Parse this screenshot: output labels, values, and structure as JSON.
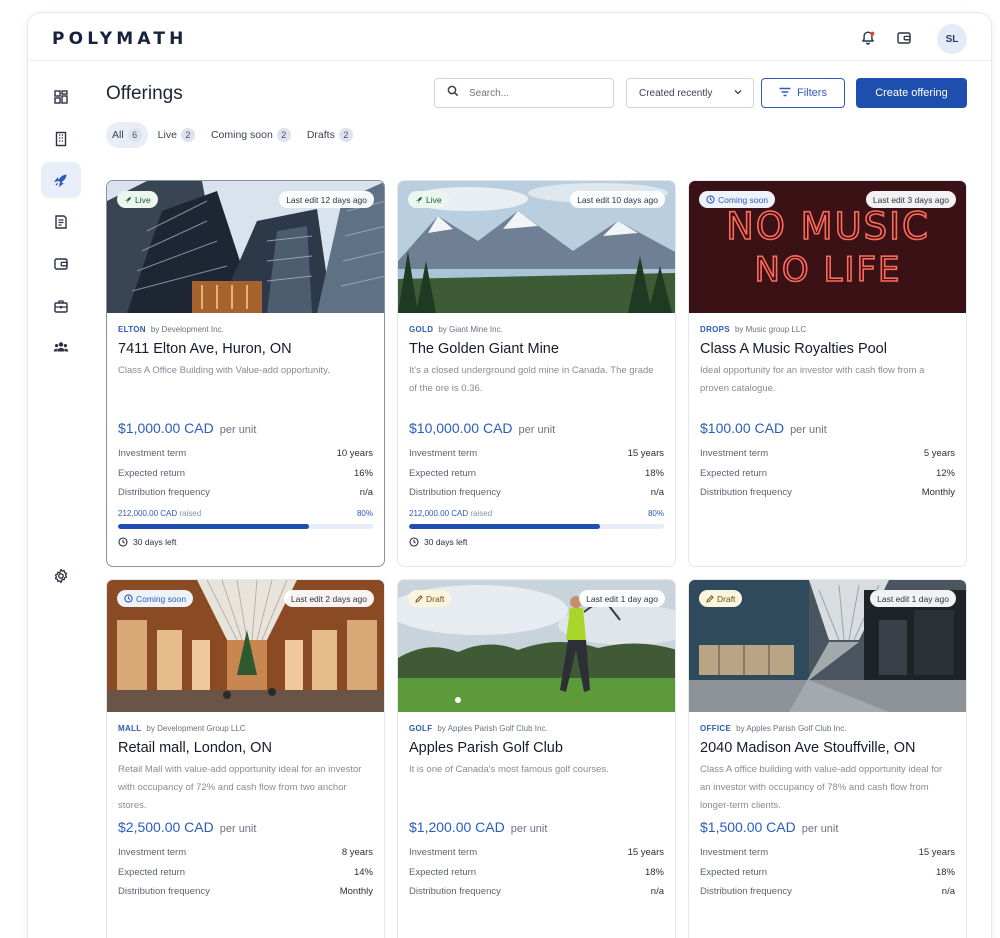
{
  "app": {
    "logo": "POLYMATH",
    "user_initials": "SL"
  },
  "page": {
    "title": "Offerings"
  },
  "toolbar": {
    "search_placeholder": "Search...",
    "sort_label": "Created recently",
    "filters_label": "Filters",
    "create_label": "Create offering"
  },
  "tabs": [
    {
      "label": "All",
      "count": "6"
    },
    {
      "label": "Live",
      "count": "2"
    },
    {
      "label": "Coming soon",
      "count": "2"
    },
    {
      "label": "Drafts",
      "count": "2"
    }
  ],
  "sidebar_icons": [
    "dashboard-icon",
    "building-icon",
    "rocket-icon",
    "document-icon",
    "wallet-icon",
    "briefcase-icon",
    "users-icon",
    "settings-icon"
  ],
  "labels": {
    "per_unit": "per unit",
    "raised": "raised"
  },
  "cards": [
    {
      "status": "Live",
      "last_edit": "Last edit 12 days ago",
      "ticker": "ELTON",
      "issuer": "by Development Inc.",
      "title": "7411 Elton Ave, Huron, ON",
      "desc": "Class A Office Building with Value-add opportunity.",
      "price": "$1,000.00 CAD",
      "rows": [
        [
          "Investment term",
          "10 years"
        ],
        [
          "Expected return",
          "16%"
        ],
        [
          "Distribution frequency",
          "n/a"
        ]
      ],
      "raised_amount": "212,000.00 CAD",
      "raised_pct": "80%",
      "progress": 0.75,
      "days_left": "30 days left"
    },
    {
      "status": "Live",
      "last_edit": "Last edit 10 days ago",
      "ticker": "GOLD",
      "issuer": "by Giant Mine Inc.",
      "title": "The Golden Giant Mine",
      "desc": "It's a closed underground gold mine in Canada. The grade of the ore is 0.36.",
      "price": "$10,000.00 CAD",
      "rows": [
        [
          "Investment term",
          "15 years"
        ],
        [
          "Expected return",
          "18%"
        ],
        [
          "Distribution frequency",
          "n/a"
        ]
      ],
      "raised_amount": "212,000.00 CAD",
      "raised_pct": "80%",
      "progress": 0.75,
      "days_left": "30 days left"
    },
    {
      "status": "Coming soon",
      "last_edit": "Last edit 3 days ago",
      "ticker": "DROPS",
      "issuer": "by Music group LLC",
      "title": "Class A Music Royalties Pool",
      "desc": "Ideal opportunity for an investor with cash flow from a proven catalogue.",
      "price": "$100.00 CAD",
      "rows": [
        [
          "Investment term",
          "5 years"
        ],
        [
          "Expected return",
          "12%"
        ],
        [
          "Distribution frequency",
          "Monthly"
        ]
      ],
      "neon_lines": [
        "NO MUSIC",
        "NO LIFE"
      ]
    },
    {
      "status": "Coming soon",
      "last_edit": "Last edit 2 days ago",
      "ticker": "MALL",
      "issuer": "by Development Group LLC",
      "title": "Retail mall, London, ON",
      "desc": "Retail Mall with value-add opportunity ideal for an investor with occupancy of 72% and cash flow from two anchor stores.",
      "price": "$2,500.00 CAD",
      "rows": [
        [
          "Investment term",
          "8 years"
        ],
        [
          "Expected return",
          "14%"
        ],
        [
          "Distribution frequency",
          "Monthly"
        ]
      ]
    },
    {
      "status": "Draft",
      "last_edit": "Last edit 1 day ago",
      "ticker": "GOLF",
      "issuer": "by Apples Parish Golf Club Inc.",
      "title": "Apples Parish Golf Club",
      "desc": "It is one of Canada's most famous golf courses.",
      "price": "$1,200.00 CAD",
      "rows": [
        [
          "Investment term",
          "15 years"
        ],
        [
          "Expected return",
          "18%"
        ],
        [
          "Distribution frequency",
          "n/a"
        ]
      ]
    },
    {
      "status": "Draft",
      "last_edit": "Last edit 1 day ago",
      "ticker": "OFFICE",
      "issuer": "by Apples Parish Golf Club Inc.",
      "title": "2040 Madison Ave Stouffville, ON",
      "desc": "Class A office building with value-add opportunity ideal for an investor with occupancy of 78% and cash flow from longer-term clients.",
      "price": "$1,500.00 CAD",
      "rows": [
        [
          "Investment term",
          "15 years"
        ],
        [
          "Expected return",
          "18%"
        ],
        [
          "Distribution frequency",
          "n/a"
        ]
      ]
    }
  ]
}
